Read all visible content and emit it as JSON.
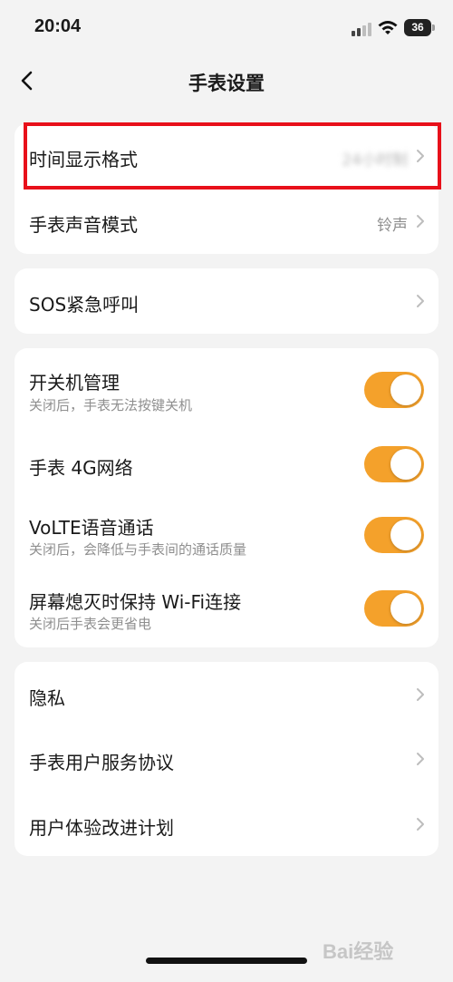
{
  "status_bar": {
    "time": "20:04",
    "battery": "36"
  },
  "nav": {
    "title": "手表设置"
  },
  "section1": {
    "time_format": {
      "label": "时间显示格式",
      "value": "24小时制"
    },
    "sound_mode": {
      "label": "手表声音模式",
      "value": "铃声"
    }
  },
  "section2": {
    "sos": {
      "label": "SOS紧急呼叫"
    }
  },
  "section3": {
    "power": {
      "label": "开关机管理",
      "sub": "关闭后，手表无法按键关机",
      "on": true
    },
    "network": {
      "label": "手表 4G网络",
      "on": true
    },
    "volte": {
      "label": "VoLTE语音通话",
      "sub": "关闭后，会降低与手表间的通话质量",
      "on": true
    },
    "wifi": {
      "label": "屏幕熄灭时保持 Wi-Fi连接",
      "sub": "关闭后手表会更省电",
      "on": true
    }
  },
  "section4": {
    "privacy": {
      "label": "隐私"
    },
    "agreement": {
      "label": "手表用户服务协议"
    },
    "ux_plan": {
      "label": "用户体验改进计划"
    }
  },
  "watermark": "Bai经验",
  "colors": {
    "accent": "#f4a12b",
    "highlight": "#e8101a",
    "background": "#f3f3f3"
  }
}
